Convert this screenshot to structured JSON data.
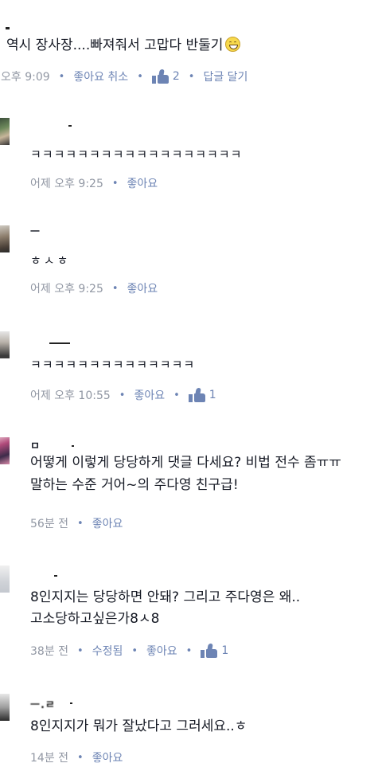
{
  "comments": [
    {
      "avatar": "user-avatar",
      "name": "",
      "text": "역시 장사장....빠져줘서 고맙다 반둘기",
      "emoji": "grinning-face-icon",
      "meta": {
        "time": "오후 9:09",
        "action1": "좋아요 취소",
        "like_count": "2",
        "action2": "답글 달기"
      }
    },
    {
      "avatar": "user-avatar",
      "name": "",
      "text": "ㅋㅋㅋㅋㅋㅋㅋㅋㅋㅋㅋㅋㅋㅋㅋㅋㅋㅋ",
      "meta": {
        "time": "어제 오후 9:25",
        "action1": "좋아요"
      }
    },
    {
      "avatar": "user-avatar",
      "name": "ㅡ",
      "text": "ㅎㅅㅎ",
      "meta": {
        "time": "어제 오후 9:25",
        "action1": "좋아요"
      }
    },
    {
      "avatar": "user-avatar",
      "name": "",
      "text": "ㅋㅋㅋㅋㅋㅋㅋㅋㅋㅋㅋㅋㅋㅋ",
      "meta": {
        "time": "어제 오후 10:55",
        "action1": "좋아요",
        "like_count": "1"
      }
    },
    {
      "avatar": "user-avatar",
      "name": "ㅁ",
      "lines": [
        "어떻게 이렇게 당당하게 댓글 다세요? 비법 전수 좀ㅠㅠ",
        "말하는 수준 거어~의 주다영 친구급!"
      ],
      "meta": {
        "time": "56분 전",
        "action1": "좋아요"
      }
    },
    {
      "avatar": "user-avatar",
      "name": "",
      "lines": [
        "8인지지는 당당하면 안돼? 그리고 주다영은 왜..",
        "고소당하고싶은가8ㅅ8"
      ],
      "meta": {
        "time": "38분 전",
        "edited": "수정됨",
        "action1": "좋아요",
        "like_count": "1"
      }
    },
    {
      "avatar": "user-avatar",
      "name": "ㅡ.ㄹ",
      "text": "8인지지가 뭐가 잘났다고 그러세요..ㅎ",
      "meta": {
        "time": "14분 전",
        "action1": "좋아요"
      }
    }
  ],
  "separator": "•"
}
